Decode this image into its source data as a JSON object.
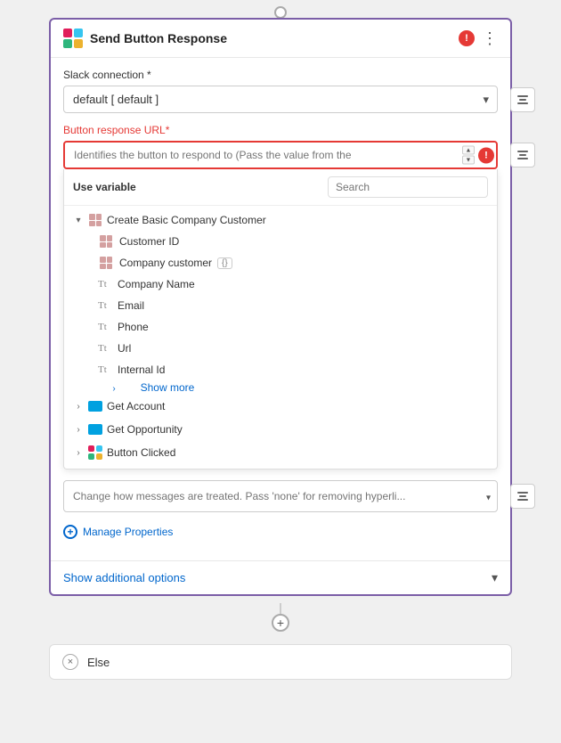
{
  "header": {
    "title": "Send Button Response",
    "error_icon": "!",
    "kebab_icon": "⋮"
  },
  "slack_connection": {
    "label": "Slack connection *",
    "value": "default [ default ]"
  },
  "button_response_url": {
    "label": "Button response URL*",
    "placeholder": "Identifies the button to respond to (Pass the value from the"
  },
  "variable_section": {
    "use_variable_label": "Use variable",
    "search_placeholder": "Search"
  },
  "tree": {
    "root_node": {
      "label": "Create Basic Company Customer",
      "expanded": true,
      "children": [
        {
          "label": "Customer ID",
          "type": "table"
        },
        {
          "label": "Company customer",
          "type": "table",
          "badge": "{}"
        },
        {
          "label": "Company Name",
          "type": "text"
        },
        {
          "label": "Email",
          "type": "text"
        },
        {
          "label": "Phone",
          "type": "text"
        },
        {
          "label": "Url",
          "type": "text"
        },
        {
          "label": "Internal Id",
          "type": "text"
        }
      ],
      "show_more": "Show more"
    },
    "other_nodes": [
      {
        "label": "Get Account",
        "type": "salesforce",
        "expanded": false
      },
      {
        "label": "Get Opportunity",
        "type": "salesforce",
        "expanded": false
      },
      {
        "label": "Button Clicked",
        "type": "slack",
        "expanded": false
      }
    ]
  },
  "bottom_field": {
    "placeholder": "Change how messages are treated. Pass 'none' for removing hyperli..."
  },
  "manage_properties": {
    "label": "Manage Properties"
  },
  "show_additional": {
    "label": "Show additional options"
  },
  "else_card": {
    "label": "Else",
    "close_icon": "×"
  },
  "colors": {
    "purple_border": "#7b5ea7",
    "error_red": "#e53935",
    "link_blue": "#0066cc",
    "salesforce_blue": "#00a1e0"
  }
}
